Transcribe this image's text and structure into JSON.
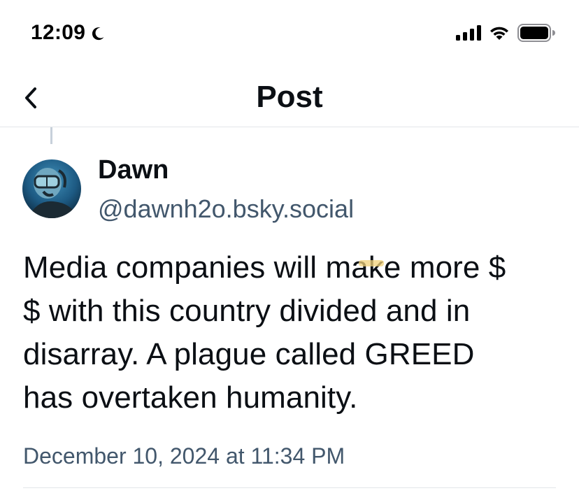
{
  "status_bar": {
    "time": "12:09",
    "icons": [
      "moon-icon",
      "signal-icon",
      "wifi-icon",
      "battery-icon"
    ]
  },
  "header": {
    "title": "Post",
    "back_icon": "chevron-left-icon"
  },
  "post": {
    "author": {
      "display_name": "Dawn",
      "handle": "@dawnh2o.bsky.social",
      "avatar_icon": "avatar-diver-icon"
    },
    "text_lines": [
      "Media companies will make more $",
      "$ with this country divided and in",
      "disarray. A plague called GREED",
      "has overtaken humanity."
    ],
    "timestamp": "December 10, 2024 at 11:34 PM"
  },
  "colors": {
    "text_primary": "#0b0f14",
    "text_secondary": "#42576c",
    "divider": "#e3e6ea",
    "thread_line": "#c7d0da"
  }
}
